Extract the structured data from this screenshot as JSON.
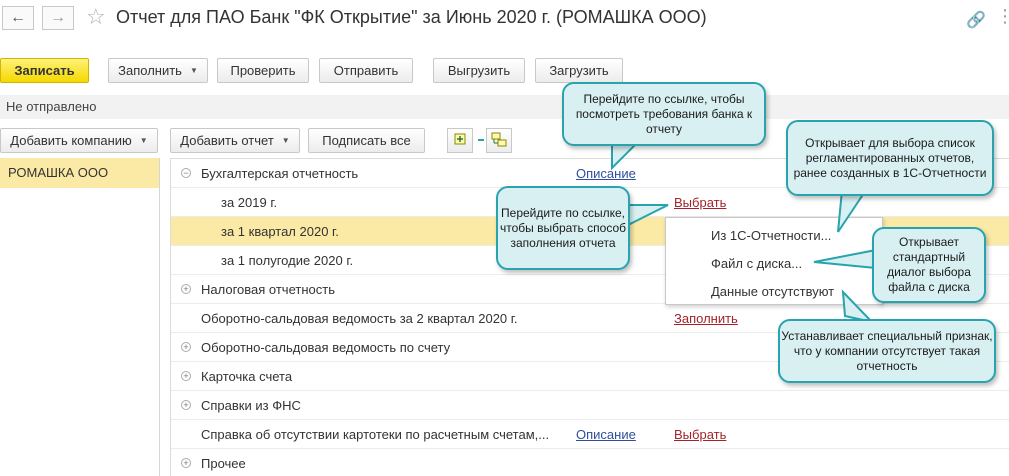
{
  "window": {
    "title": "Отчет для ПАО Банк \"ФК Открытие\" за Июнь 2020 г. (РОМАШКА ООО)"
  },
  "toolbar": {
    "save": "Записать",
    "fill": "Заполнить",
    "check": "Проверить",
    "send": "Отправить",
    "upload": "Выгрузить",
    "download": "Загрузить"
  },
  "status": "Не отправлено",
  "left": {
    "add_company": "Добавить компанию",
    "companies": [
      "РОМАШКА ООО"
    ]
  },
  "right_toolbar": {
    "add_report": "Добавить отчет",
    "sign_all": "Подписать все"
  },
  "tree": {
    "rows": [
      {
        "label": "Бухгалтерская отчетность",
        "link": "Описание",
        "link_type": "blue"
      },
      {
        "label": "за 2019 г.",
        "link": "Выбрать",
        "link_type": "red"
      },
      {
        "label": "за 1 квартал 2020 г.",
        "link": "",
        "link_type": ""
      },
      {
        "label": "за 1 полугодие 2020 г.",
        "link": "",
        "link_type": ""
      },
      {
        "label": "Налоговая отчетность",
        "link": "",
        "link_type": ""
      },
      {
        "label": "Оборотно-сальдовая ведомость за 2 квартал 2020 г.",
        "link": "Заполнить",
        "link_type": "red"
      },
      {
        "label": "Оборотно-сальдовая ведомость по счету",
        "link": "",
        "link_type": ""
      },
      {
        "label": "Карточка счета",
        "link": "",
        "link_type": ""
      },
      {
        "label": "Справки из ФНС",
        "link": "",
        "link_type": ""
      },
      {
        "label": "Справка об отсутствии картотеки по расчетным счетам,...",
        "link": "Описание",
        "link2": "Выбрать"
      },
      {
        "label": "Прочее",
        "link": "",
        "link_type": ""
      }
    ]
  },
  "menu": {
    "items": [
      "Из 1С-Отчетности...",
      "Файл с диска...",
      "Данные отсутствуют"
    ]
  },
  "callouts": {
    "description_link": "Перейдите по ссылке, чтобы посмотреть требования банка к отчету",
    "choose_link": "Перейдите по ссылке, чтобы выбрать способ заполнения отчета",
    "from_1c": "Открывает для выбора список регламентированных отчетов, ранее созданных в 1С-Отчетности",
    "from_file": "Открывает стандартный диалог выбора файла с диска",
    "no_data": "Устанавливает специальный признак, что у компании отсутствует такая отчетность"
  },
  "colors": {
    "primary_button": "#f5d800",
    "selection": "#fbeaa6",
    "callout_border": "#29a3ad",
    "callout_bg": "#d9f0f2",
    "link_blue": "#2f4f9a",
    "link_red": "#a3232a"
  }
}
